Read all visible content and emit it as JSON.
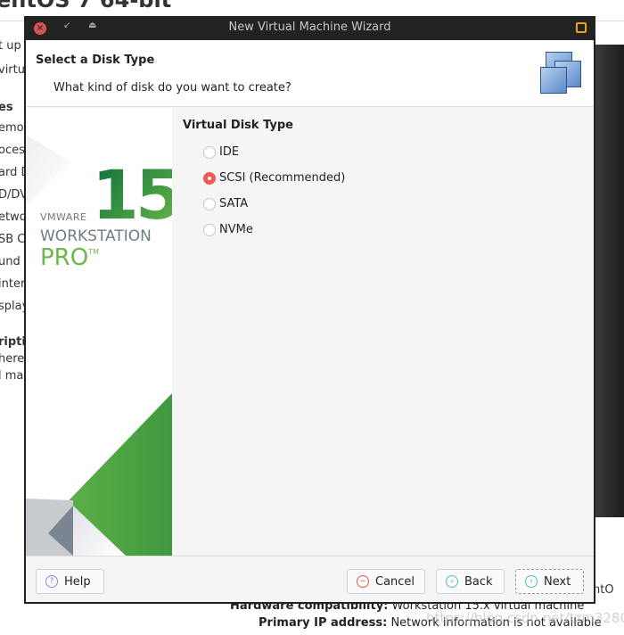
{
  "background": {
    "title_fragment": "entOS 7 64-bit",
    "left_fragments": [
      {
        "text": "t up",
        "bold": false
      },
      {
        "text": "virtu",
        "bold": false
      },
      {
        "text": "es",
        "bold": true
      },
      {
        "text": "emo",
        "bold": false
      },
      {
        "text": "oces",
        "bold": false
      },
      {
        "text": "ard D",
        "bold": false
      },
      {
        "text": "D/DV",
        "bold": false
      },
      {
        "text": "etwo",
        "bold": false
      },
      {
        "text": "SB Co",
        "bold": false
      },
      {
        "text": "und",
        "bold": false
      },
      {
        "text": "inter",
        "bold": false
      },
      {
        "text": "splay",
        "bold": false
      },
      {
        "text": "riptio",
        "bold": true
      },
      {
        "text": "here",
        "bold": false
      },
      {
        "text": "l ma",
        "bold": false
      }
    ],
    "right_fragment": "entO",
    "hardware_label": "Hardware compatibility:",
    "hardware_value": "Workstation 15.x virtual machine",
    "ip_label": "Primary IP address:",
    "ip_value": "Network information is not available",
    "watermark": "https://blog.csdn.net/tzm3280"
  },
  "window": {
    "title": "New Virtual Machine Wizard"
  },
  "header": {
    "title": "Select a Disk Type",
    "subtitle": "What kind of disk do you want to create?"
  },
  "branding": {
    "version": "15",
    "vendor": "VMWARE",
    "product": "WORKSTATION",
    "edition": "PRO",
    "tm": "TM"
  },
  "disk_type": {
    "heading": "Virtual Disk Type",
    "options": [
      {
        "label": "IDE",
        "selected": false
      },
      {
        "label": "SCSI (Recommended)",
        "selected": true
      },
      {
        "label": "SATA",
        "selected": false
      },
      {
        "label": "NVMe",
        "selected": false
      }
    ]
  },
  "buttons": {
    "help": "Help",
    "cancel": "Cancel",
    "back": "Back",
    "next": "Next"
  },
  "colors": {
    "accent_radio": "#ee5a52",
    "brand_green": "#4a9e3f",
    "titlebar": "#222222"
  }
}
